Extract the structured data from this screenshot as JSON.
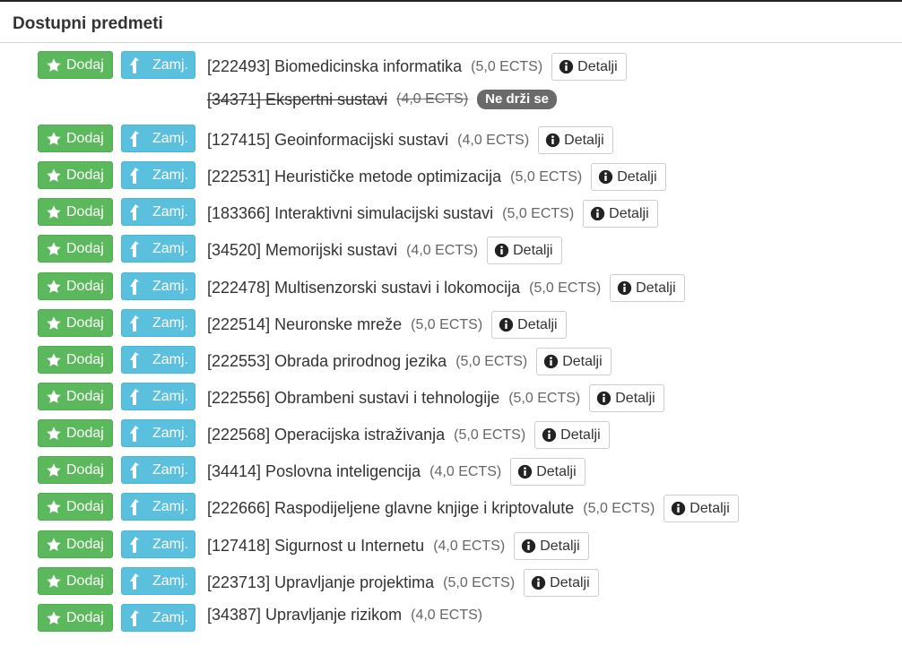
{
  "section": {
    "title": "Dostupni predmeti"
  },
  "buttons": {
    "add_label": "Dodaj",
    "replace_label": "Zamj.",
    "details_label": "Detalji"
  },
  "icons": {
    "add": "star-icon",
    "replace": "replace-icon",
    "details": "info-circle-icon"
  },
  "colors": {
    "add": "#5cb85c",
    "replace": "#5bc0de",
    "badge": "#6a6a6a"
  },
  "courses": [
    {
      "name": "[222493] Biomedicinska informatika",
      "ects": "(5,0 ECTS)",
      "actions": true,
      "details": true
    },
    {
      "name": "[34371] Ekspertni sustavi",
      "ects": "(4,0 ECTS)",
      "actions": false,
      "details": false,
      "struck": true,
      "badge": "Ne drži se"
    },
    {
      "name": "[127415] Geoinformacijski sustavi",
      "ects": "(4,0 ECTS)",
      "actions": true,
      "details": true
    },
    {
      "name": "[222531] Heurističke metode optimizacija",
      "ects": "(5,0 ECTS)",
      "actions": true,
      "details": true
    },
    {
      "name": "[183366] Interaktivni simulacijski sustavi",
      "ects": "(5,0 ECTS)",
      "actions": true,
      "details": true
    },
    {
      "name": "[34520] Memorijski sustavi",
      "ects": "(4,0 ECTS)",
      "actions": true,
      "details": true
    },
    {
      "name": "[222478] Multisenzorski sustavi i lokomocija",
      "ects": "(5,0 ECTS)",
      "actions": true,
      "details": true
    },
    {
      "name": "[222514] Neuronske mreže",
      "ects": "(5,0 ECTS)",
      "actions": true,
      "details": true
    },
    {
      "name": "[222553] Obrada prirodnog jezika",
      "ects": "(5,0 ECTS)",
      "actions": true,
      "details": true
    },
    {
      "name": "[222556] Obrambeni sustavi i tehnologije",
      "ects": "(5,0 ECTS)",
      "actions": true,
      "details": true
    },
    {
      "name": "[222568] Operacijska istraživanja",
      "ects": "(5,0 ECTS)",
      "actions": true,
      "details": true
    },
    {
      "name": "[34414] Poslovna inteligencija",
      "ects": "(4,0 ECTS)",
      "actions": true,
      "details": true
    },
    {
      "name": "[222666] Raspodijeljene glavne knjige i kriptovalute",
      "ects": "(5,0 ECTS)",
      "actions": true,
      "details": true
    },
    {
      "name": "[127418] Sigurnost u Internetu",
      "ects": "(4,0 ECTS)",
      "actions": true,
      "details": true
    },
    {
      "name": "[223713] Upravljanje projektima",
      "ects": "(5,0 ECTS)",
      "actions": true,
      "details": true
    },
    {
      "name": "[34387] Upravljanje rizikom",
      "ects": "(4,0 ECTS)",
      "actions": true,
      "details": false
    }
  ]
}
